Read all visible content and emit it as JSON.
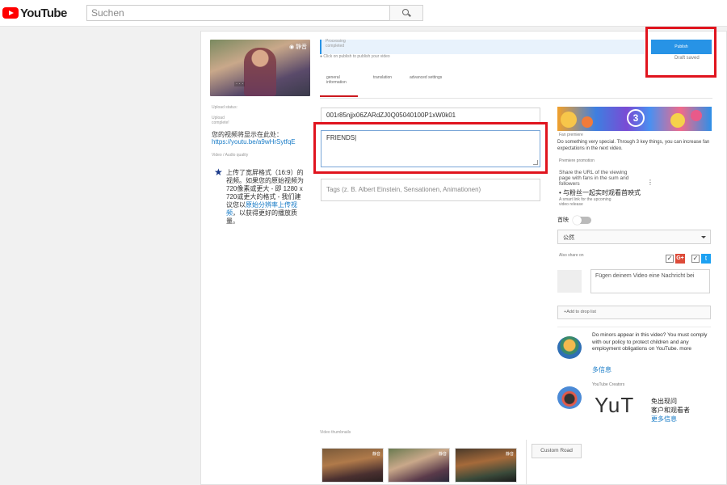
{
  "header": {
    "logo_text": "YouTube",
    "search_placeholder": "Suchen"
  },
  "left": {
    "thumbnail_watermark": "◉ 静音",
    "upload_status_label": "Upload status:",
    "status_line_1": "Upload",
    "status_line_2": "complete!",
    "share_label": "您的视频将显示在此处：",
    "share_link": "https://youtu.be/a9wHrSytfqE",
    "divider_note": "Video / Audio quality",
    "tip_text": "上传了宽屏格式（16:9）的视频。如果您的原始视频为720像素或更大 - 即 1280 x 720或更大的格式 - 我们建议您以",
    "tip_link": "原始分辨率上传视频",
    "tip_end": "，以获得更好的播放质量。"
  },
  "progress": {
    "line_1": "Processing",
    "line_2": "completed",
    "hint": "Click on publish to publish your video"
  },
  "actions": {
    "publish_label": "Publish",
    "saved_label": "Draft saved"
  },
  "tabs": [
    {
      "label": "general information"
    },
    {
      "label": "translation"
    },
    {
      "label": "advanced settings"
    }
  ],
  "form": {
    "title_value": "001r85njjx06ZARdZJ0Q05040100P1xW0k01",
    "description_value": "FRIENDS",
    "tags_placeholder": "Tags (z. B. Albert Einstein, Sensationen, Animationen)"
  },
  "right": {
    "banner_number": "3",
    "banner_caption": "Fan premiere",
    "lead_text": "Do something very special. Through 3 key things, you can increase fan expectations in the next video.",
    "sub_label": "Premiere promotion",
    "share_fans": "Share the URL of the viewing page with fans in the sum and followers",
    "cn_bullet": "• 与粉丝一起实时观看首映式",
    "bullet_more": "A smart link for the upcoming",
    "bullet_more_2": "video release",
    "premiere_label": "首映",
    "privacy_value": "公然",
    "share_label": "Also share on",
    "message_placeholder": "Fügen deinem Video eine Nachricht bei",
    "playlist_label": "+Add to drop list",
    "minors_text": "Do minors appear in this video? You must comply with our policy to protect children and any employment obligations on YouTube.",
    "minors_more_word": "more",
    "more_link": "多信息",
    "promo_heading": "YouTube Creators",
    "yut_text": "YuT",
    "free_text_1": "免出现问",
    "free_text_2": "客户和观看者",
    "free_link": "更多信息"
  },
  "thumbnails": {
    "label": "Video thumbnails",
    "tag": "静音",
    "custom_button": "Custom Road"
  },
  "colors": {
    "brand_red": "#ff0000",
    "highlight_red": "#e0141e",
    "link_blue": "#167ac6",
    "publish_blue": "#2793e6"
  }
}
